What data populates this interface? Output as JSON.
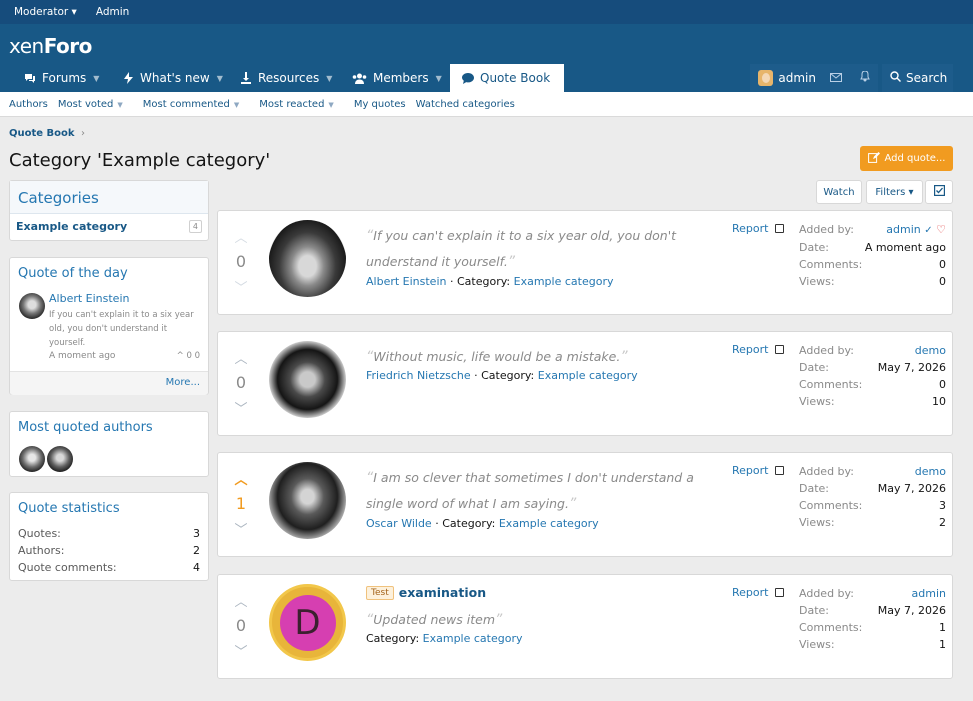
{
  "topbar": {
    "moderator": "Moderator ▾",
    "admin": "Admin"
  },
  "header": {
    "logo_a": "xen",
    "logo_b": "Foro"
  },
  "nav": {
    "tabs": [
      {
        "label": "Forums"
      },
      {
        "label": "What's new"
      },
      {
        "label": "Resources"
      },
      {
        "label": "Members"
      },
      {
        "label": "Quote Book"
      }
    ],
    "user": "admin",
    "search": "Search"
  },
  "subnav": {
    "items": [
      "Authors",
      "Most voted",
      "Most commented",
      "Most reacted",
      "My quotes",
      "Watched categories"
    ]
  },
  "breadcrumb": "Quote Book",
  "page_title": "Category 'Example category'",
  "add_quote": "Add quote...",
  "toolbar": {
    "watch": "Watch",
    "filters": "Filters ▾"
  },
  "sidebar": {
    "categories": {
      "title": "Categories",
      "item": "Example category",
      "count": "4"
    },
    "qotd": {
      "title": "Quote of the day",
      "author": "Albert Einstein",
      "text": "If you can't explain it to a six year old, you don't understand it yourself.",
      "time": "A moment ago",
      "stats": "0 0",
      "more": "More..."
    },
    "most_quoted": {
      "title": "Most quoted authors"
    },
    "stats": {
      "title": "Quote statistics",
      "rows": [
        {
          "k": "Quotes:",
          "v": "3"
        },
        {
          "k": "Authors:",
          "v": "2"
        },
        {
          "k": "Quote comments:",
          "v": "4"
        }
      ]
    }
  },
  "labels": {
    "report": "Report",
    "added_by": "Added by:",
    "date": "Date:",
    "comments": "Comments:",
    "views": "Views:",
    "category": "Category:",
    "sep": "·"
  },
  "quotes": [
    {
      "votes": "0",
      "text": "If you can't explain it to a six year old, you don't understand it yourself.",
      "author": "Albert Einstein",
      "category": "Example category",
      "added_by": "admin",
      "date": "A moment ago",
      "comments": "0",
      "views": "0"
    },
    {
      "votes": "0",
      "text": "Without music, life would be a mistake.",
      "author": "Friedrich Nietzsche",
      "category": "Example category",
      "added_by": "demo",
      "date": "May 7, 2026",
      "comments": "0",
      "views": "10"
    },
    {
      "votes": "1",
      "text": "I am so clever that sometimes I don't understand a single word of what I am saying.",
      "author": "Oscar Wilde",
      "category": "Example category",
      "added_by": "demo",
      "date": "May 7, 2026",
      "comments": "3",
      "views": "2"
    },
    {
      "votes": "0",
      "tag": "Test",
      "title": "examination",
      "text": "Updated news item",
      "avatar_letter": "D",
      "category": "Example category",
      "added_by": "admin",
      "date": "May 7, 2026",
      "comments": "1",
      "views": "1"
    }
  ]
}
